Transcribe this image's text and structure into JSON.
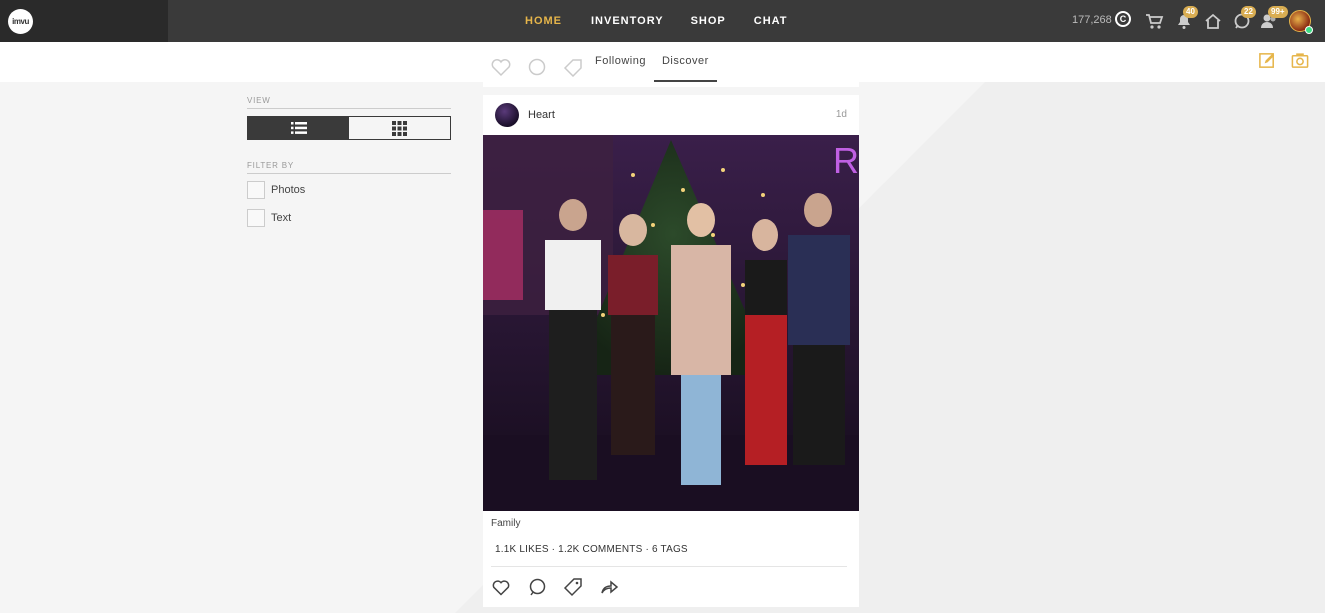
{
  "nav": {
    "logo_text": "imvu",
    "items": [
      {
        "label": "HOME",
        "active": true
      },
      {
        "label": "INVENTORY",
        "active": false
      },
      {
        "label": "SHOP",
        "active": false
      },
      {
        "label": "CHAT",
        "active": false
      }
    ],
    "credits": "177,268",
    "credit_symbol": "C",
    "badges": {
      "notifications": "40",
      "messages": "22",
      "friends": "99+"
    },
    "accent_color": "#e6b54a"
  },
  "tabs": [
    {
      "label": "Following",
      "active": false
    },
    {
      "label": "Discover",
      "active": true
    }
  ],
  "sidebar": {
    "view_heading": "VIEW",
    "view_selected": "list",
    "filter_heading": "FILTER BY",
    "filters": [
      {
        "label": "Photos",
        "checked": false
      },
      {
        "label": "Text",
        "checked": false
      }
    ]
  },
  "post": {
    "username": "Heart",
    "age": "1d",
    "caption": "Family",
    "stats": "1.1K LIKES · 1.2K COMMENTS · 6 TAGS"
  }
}
